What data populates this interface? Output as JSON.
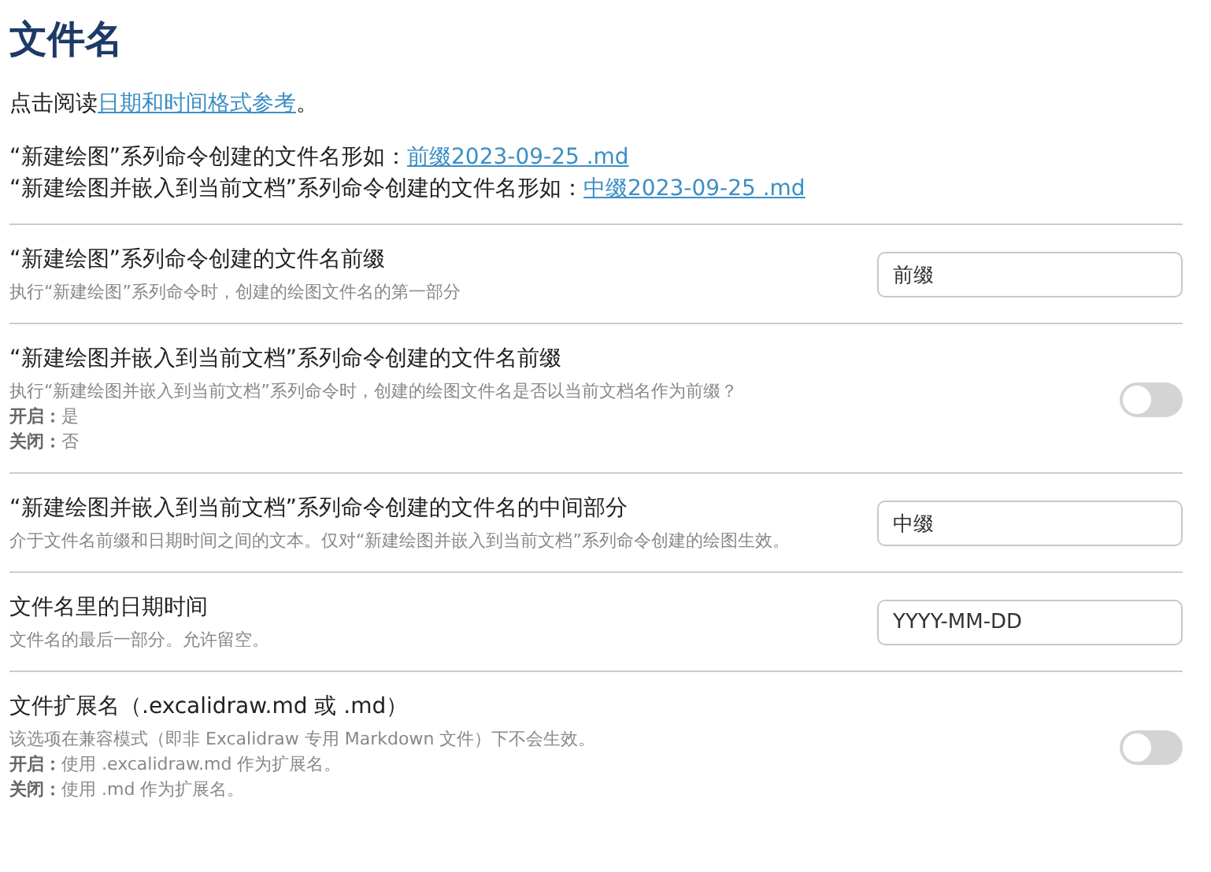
{
  "heading": "文件名",
  "intro": {
    "before": "点击阅读",
    "link": "日期和时间格式参考",
    "after": "。"
  },
  "examples": [
    {
      "text": "“新建绘图”系列命令创建的文件名形如：",
      "link": "前缀2023-09-25 .md"
    },
    {
      "text": "“新建绘图并嵌入到当前文档”系列命令创建的文件名形如：",
      "link": "中缀2023-09-25 .md"
    }
  ],
  "settings": [
    {
      "kind": "text",
      "name": "“新建绘图”系列命令创建的文件名前缀",
      "description": [
        "执行“新建绘图”系列命令时，创建的绘图文件名的第一部分"
      ],
      "value": "前缀"
    },
    {
      "kind": "toggle",
      "name": "“新建绘图并嵌入到当前文档”系列命令创建的文件名前缀",
      "description": [
        "执行“新建绘图并嵌入到当前文档”系列命令时，创建的绘图文件名是否以当前文档名作为前缀？",
        "**开启：**是",
        "**关闭：**否"
      ],
      "on": false
    },
    {
      "kind": "text",
      "name": "“新建绘图并嵌入到当前文档”系列命令创建的文件名的中间部分",
      "description": [
        "介于文件名前缀和日期时间之间的文本。仅对“新建绘图并嵌入到当前文档”系列命令创建的绘图生效。"
      ],
      "value": "中缀"
    },
    {
      "kind": "text",
      "name": "文件名里的日期时间",
      "description": [
        "文件名的最后一部分。允许留空。"
      ],
      "value": "YYYY-MM-DD"
    },
    {
      "kind": "toggle",
      "name": "文件扩展名（.excalidraw.md 或 .md）",
      "description": [
        "该选项在兼容模式（即非 Excalidraw 专用 Markdown 文件）下不会生效。",
        "**开启：**使用 .excalidraw.md 作为扩展名。",
        "**关闭：**使用 .md 作为扩展名。"
      ],
      "on": false
    }
  ]
}
